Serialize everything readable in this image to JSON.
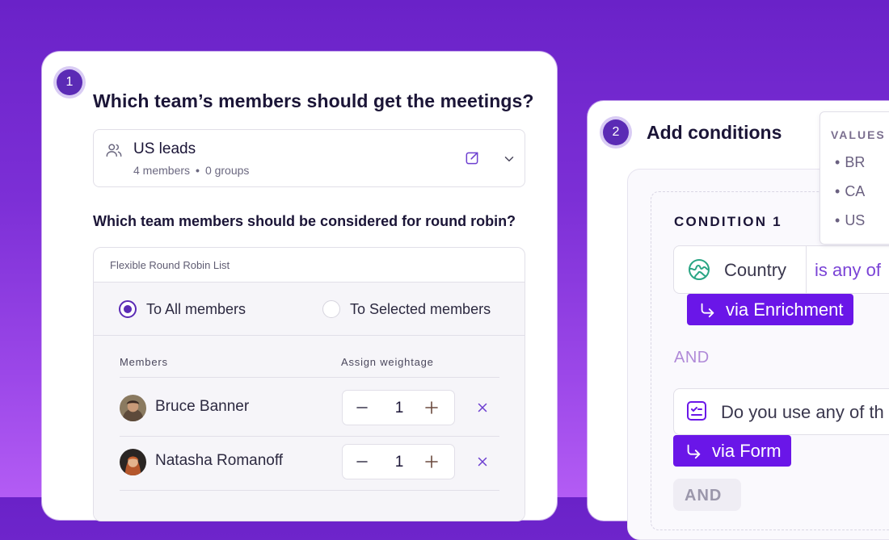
{
  "step1": {
    "badge": "1",
    "question": "Which team’s members should get the meetings?",
    "team_select": {
      "name": "US leads",
      "members_count": "4 members",
      "groups_count": "0 groups"
    },
    "round_robin_question": "Which team members should be considered for round robin?",
    "list_label": "Flexible Round Robin List",
    "options": [
      {
        "label": "To All members",
        "checked": true
      },
      {
        "label": "To Selected members",
        "checked": false
      }
    ],
    "columns": {
      "members": "Members",
      "weight": "Assign weightage"
    },
    "members": [
      {
        "name": "Bruce Banner",
        "weight": "1"
      },
      {
        "name": "Natasha Romanoff",
        "weight": "1"
      }
    ]
  },
  "step2": {
    "badge": "2",
    "title": "Add conditions",
    "condition_label": "CONDITION 1",
    "condition1": {
      "field": "Country",
      "operator": "is any of",
      "source": "via Enrichment",
      "icon": "globe-icon"
    },
    "connector": "AND",
    "condition2": {
      "question": "Do you use any of th",
      "source": "via Form",
      "icon": "form-icon"
    },
    "add_connector": "AND",
    "values_popover": {
      "heading": "VALUES",
      "items": [
        "BR",
        "CA",
        "US"
      ]
    }
  },
  "colors": {
    "accent": "#5b2bb5",
    "tag": "#6a16e8",
    "background_top": "#6a22c8",
    "background_bottom": "#b35cf4"
  }
}
